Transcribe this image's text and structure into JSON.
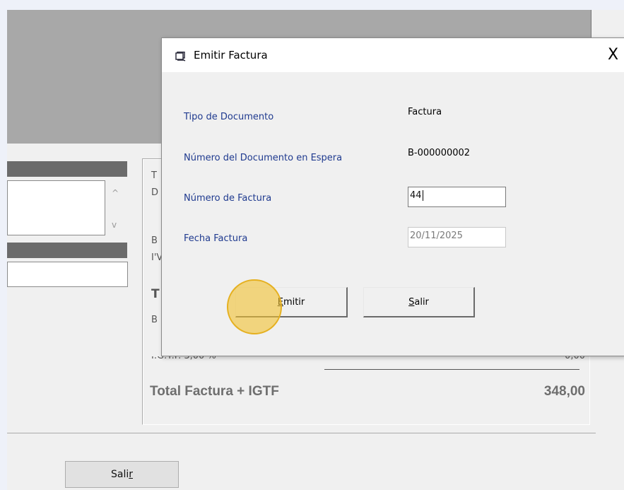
{
  "background_form": {
    "totals_partial_labels": [
      "T",
      "D",
      "B",
      "I'V",
      "T",
      "B"
    ],
    "igtf_label": "I.G.T.F. 3,00 %",
    "igtf_value": "0,00",
    "total_label": "Total Factura + IGTF",
    "total_value": "348,00",
    "salir_button": {
      "prefix": "Sali",
      "accel": "r"
    }
  },
  "dialog": {
    "title": "Emitir Factura",
    "close_label": "X",
    "fields": {
      "tipo_label": "Tipo de Documento",
      "tipo_value": "Factura",
      "numero_espera_label": "Número del Documento en Espera",
      "numero_espera_value": "B-000000002",
      "numero_factura_label": "Número de Factura",
      "numero_factura_value": "44",
      "fecha_label": "Fecha Factura",
      "fecha_value": "20/11/2025"
    },
    "buttons": {
      "emitir_accel": "E",
      "emitir_rest": "mitir",
      "salir_accel": "S",
      "salir_rest": "alir"
    }
  },
  "colors": {
    "label_blue": "#1f3a8f",
    "cursor_highlight": "#f2c230"
  }
}
